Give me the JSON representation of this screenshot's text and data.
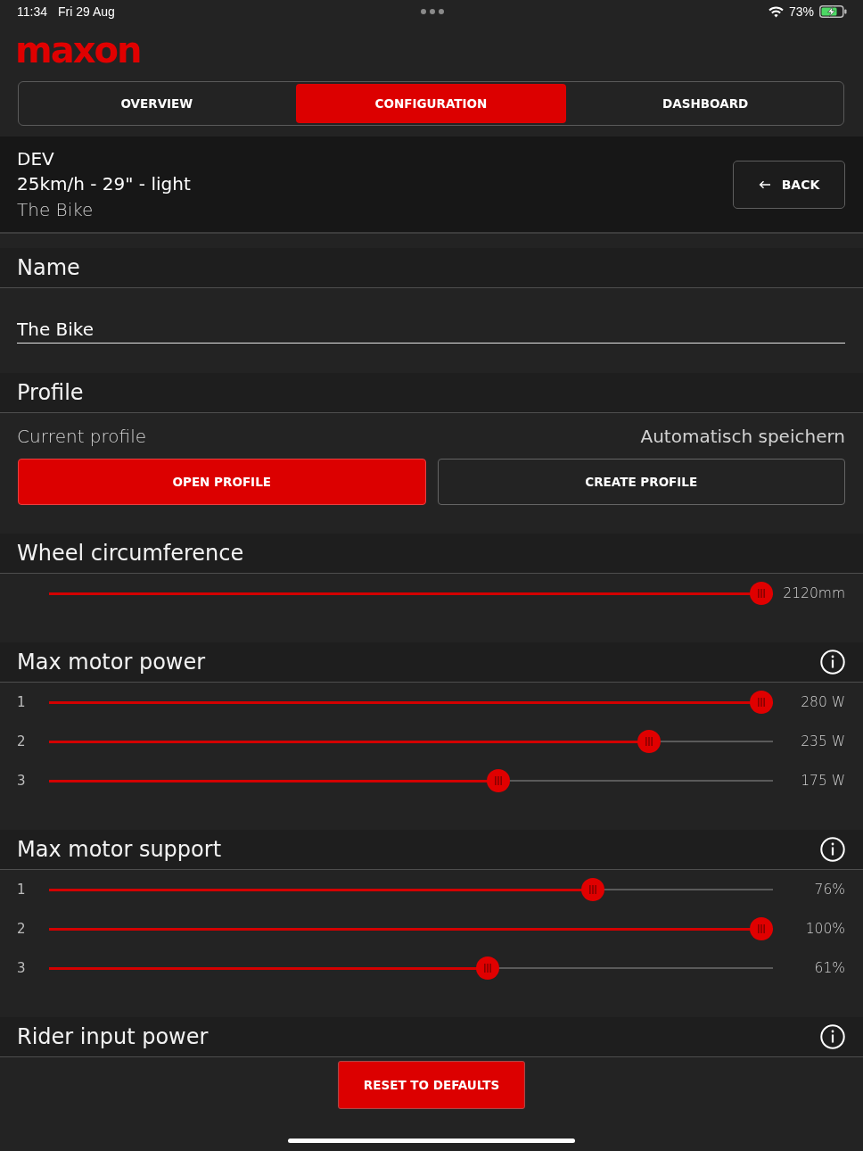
{
  "status_bar": {
    "time": "11:34",
    "date": "Fri 29 Aug",
    "battery": "73%"
  },
  "logo": "maxon",
  "tabs": [
    {
      "label": "OVERVIEW",
      "selected": false
    },
    {
      "label": "CONFIGURATION",
      "selected": true
    },
    {
      "label": "DASHBOARD",
      "selected": false
    }
  ],
  "header": {
    "profile_name": "DEV",
    "profile_details": "25km/h - 29\" - light",
    "bike_name": "The Bike",
    "back_button": "BACK"
  },
  "sections": [
    {
      "kind": "field",
      "title": "Name",
      "info": false,
      "value": "The Bike"
    },
    {
      "kind": "profile",
      "title": "Profile",
      "info": false,
      "label": "Current profile",
      "note": "Automatisch speichern",
      "buttons": [
        {
          "label": "OPEN PROFILE",
          "primary": true
        },
        {
          "label": "CREATE PROFILE",
          "primary": false
        }
      ]
    },
    {
      "kind": "sliders",
      "title": "Wheel circumference",
      "info": false,
      "sliders": [
        {
          "level": 1,
          "reading": "2120mm"
        }
      ]
    },
    {
      "kind": "sliders",
      "title": "Max motor power",
      "info": true,
      "sliders": [
        {
          "label": "1",
          "level": 1,
          "reading": "280 W"
        },
        {
          "label": "2",
          "level": 0.84,
          "reading": "235 W"
        },
        {
          "label": "3",
          "level": 0.625,
          "reading": "175 W"
        }
      ]
    },
    {
      "kind": "sliders",
      "title": "Max motor support",
      "info": true,
      "sliders": [
        {
          "label": "1",
          "level": 0.76,
          "reading": "76%"
        },
        {
          "label": "2",
          "level": 1,
          "reading": "100%"
        },
        {
          "label": "3",
          "level": 0.61,
          "reading": "61%"
        }
      ]
    },
    {
      "kind": "header",
      "title": "Rider input power",
      "info": true
    }
  ],
  "reset_button": "RESET TO DEFAULTS"
}
